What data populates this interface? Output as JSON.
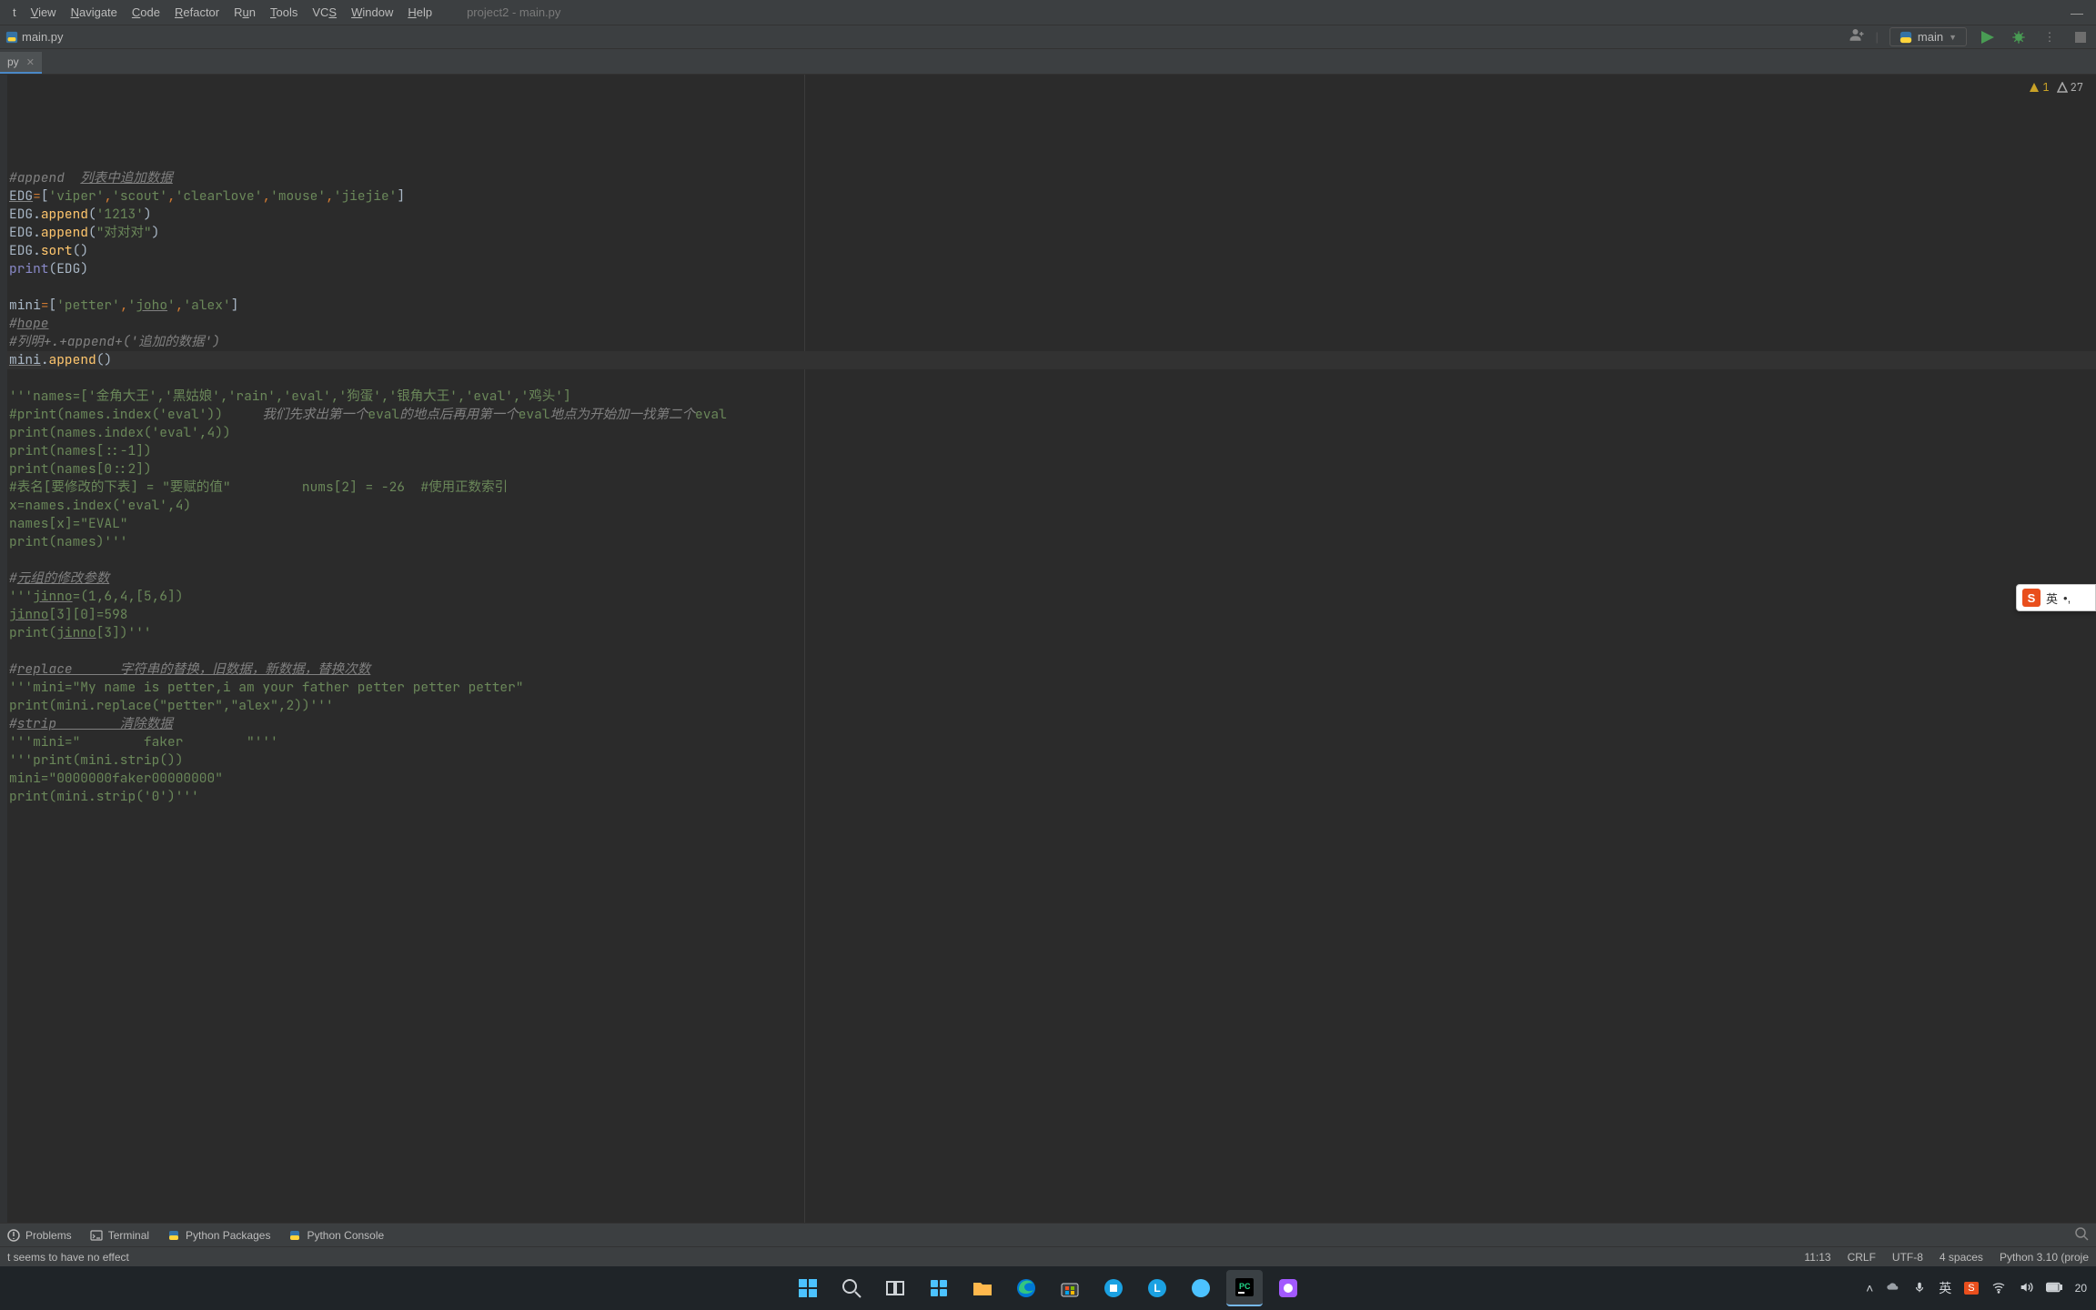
{
  "menu": {
    "items": [
      "View",
      "Navigate",
      "Code",
      "Refactor",
      "Run",
      "Tools",
      "VCS",
      "Window",
      "Help"
    ],
    "first_partial": "t"
  },
  "window": {
    "project_title": "project2 - main.py"
  },
  "breadcrumb": {
    "file": "main.py"
  },
  "run_config": {
    "name": "main"
  },
  "tabs": [
    {
      "label": "py"
    }
  ],
  "inspections": {
    "warn_count": "1",
    "typo_count": "27"
  },
  "code_lines": [
    {
      "html": "<span class='c-comment'>#append  <span class='c-underline'>列表中追加数据</span></span>"
    },
    {
      "html": "<span class='c-ident'><span class='c-underline'>EDG</span></span><span class='c-special'>=</span>[<span class='c-string'>'viper'</span><span class='c-special'>,</span><span class='c-string'>'scout'</span><span class='c-special'>,</span><span class='c-string'>'clearlove'</span><span class='c-special'>,</span><span class='c-string'>'mouse'</span><span class='c-special'>,</span><span class='c-string'>'jiejie'</span>]"
    },
    {
      "html": "<span class='c-ident'>EDG</span>.<span class='c-func'>append</span>(<span class='c-string'>'1213'</span>)"
    },
    {
      "html": "<span class='c-ident'>EDG</span>.<span class='c-func'>append</span>(<span class='c-string'>\"对对对\"</span>)"
    },
    {
      "html": "<span class='c-ident'>EDG</span>.<span class='c-func'>sort</span>()"
    },
    {
      "html": "<span class='c-builtin'>print</span>(<span class='c-ident'>EDG</span>)"
    },
    {
      "html": ""
    },
    {
      "html": "<span class='c-ident'>mini</span><span class='c-special'>=</span>[<span class='c-string'>'petter'</span><span class='c-special'>,</span><span class='c-string'>'<span class='c-underline'>joho</span>'</span><span class='c-special'>,</span><span class='c-string'>'alex'</span>]"
    },
    {
      "html": "<span class='c-comment'>#<span class='c-underline'>hope</span></span>"
    },
    {
      "html": "<span class='c-comment'>#列明+.+append+('追加的数据')</span>"
    },
    {
      "html": "<span class='c-ident'><span class='c-underline'>mini</span></span>.<span class='c-func'>append</span>()",
      "current": true
    },
    {
      "html": ""
    },
    {
      "html": "<span class='c-string'>'''names=['金角大王','黑姑娘','rain','eval','狗蛋','银角大王','eval','鸡头']</span>"
    },
    {
      "html": "<span class='c-string'>#print(names.index('eval'))     </span><span class='c-comment'>我们先求出第一个</span><span class='c-string'>eval</span><span class='c-comment'>的地点后再用第一个</span><span class='c-string'>eval</span><span class='c-comment'>地点为开始加一找第二个</span><span class='c-string'>eval</span>"
    },
    {
      "html": "<span class='c-string'>print(names.index('eval',4))</span>"
    },
    {
      "html": "<span class='c-string'>print(names[::-1])</span>"
    },
    {
      "html": "<span class='c-string'>print(names[0::2])</span>"
    },
    {
      "html": "<span class='c-string'>#表名[要修改的下表] = \"要赋的值\"         nums[2] = -26  #使用正数索引</span>"
    },
    {
      "html": "<span class='c-string'>x=names.index('eval',4)</span>"
    },
    {
      "html": "<span class='c-string'>names[x]=\"EVAL\"</span>"
    },
    {
      "html": "<span class='c-string'>print(names)'''</span>"
    },
    {
      "html": ""
    },
    {
      "html": "<span class='c-comment'>#<span class='c-underline'>元组的修改参数</span></span>"
    },
    {
      "html": "<span class='c-string'>'''<span class='c-underline'>jinno</span>=(1,6,4,[5,6])</span>"
    },
    {
      "html": "<span class='c-string'><span class='c-underline'>jinno</span>[3][0]=598</span>"
    },
    {
      "html": "<span class='c-string'>print(<span class='c-underline'>jinno</span>[3])'''</span>"
    },
    {
      "html": ""
    },
    {
      "html": "<span class='c-comment'>#<span class='c-underline'>replace      字符串的替换，旧数据，新数据，替换次数</span></span>"
    },
    {
      "html": "<span class='c-string'>'''mini=\"My name is petter,i am your father petter petter petter\"</span>"
    },
    {
      "html": "<span class='c-string'>print(mini.replace(\"petter\",\"alex\",2))'''</span>"
    },
    {
      "html": "<span class='c-comment'>#<span class='c-underline'>strip        清除数据</span></span>"
    },
    {
      "html": "<span class='c-string'>'''mini=\"        faker        \"'''</span>"
    },
    {
      "html": "<span class='c-string'>'''print(mini.strip())</span>"
    },
    {
      "html": "<span class='c-string'>mini=\"0000000faker00000000\"</span>"
    },
    {
      "html": "<span class='c-string'>print(mini.strip('0')'''</span>"
    }
  ],
  "tool_windows": {
    "problems": "Problems",
    "terminal": "Terminal",
    "python_packages": "Python Packages",
    "python_console": "Python Console"
  },
  "status": {
    "message": "t seems to have no effect",
    "position": "11:13",
    "line_sep": "CRLF",
    "encoding": "UTF-8",
    "indent": "4 spaces",
    "interpreter": "Python 3.10 (proje"
  },
  "ime": {
    "logo": "S",
    "mode": "英",
    "extra": "•,"
  },
  "taskbar": {
    "tray": {
      "lang": "英",
      "time_bottom": "20"
    }
  }
}
